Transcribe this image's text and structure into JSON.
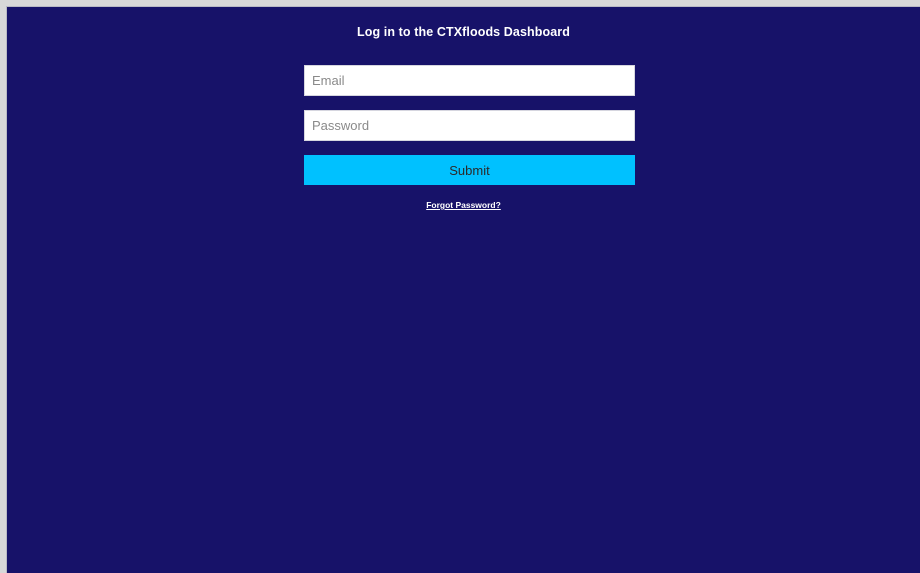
{
  "page": {
    "title": "Log in to the CTXfloods Dashboard"
  },
  "form": {
    "email_placeholder": "Email",
    "email_value": "",
    "password_placeholder": "Password",
    "password_value": "",
    "submit_label": "Submit",
    "forgot_password_label": "Forgot Password?"
  },
  "colors": {
    "background": "#171269",
    "submit_button": "#00c1ff",
    "input_background": "#ffffff",
    "title_text": "#ffffff"
  }
}
